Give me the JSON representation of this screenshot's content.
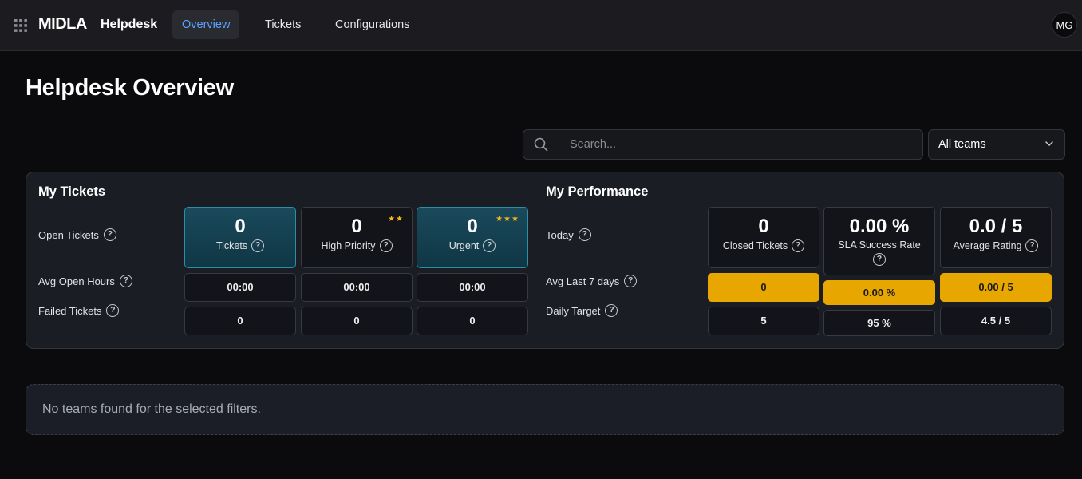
{
  "header": {
    "brand": "MIDLA",
    "module": "Helpdesk",
    "nav": [
      {
        "label": "Overview",
        "active": true
      },
      {
        "label": "Tickets",
        "active": false
      },
      {
        "label": "Configurations",
        "active": false
      }
    ],
    "user_initials": "MG"
  },
  "page": {
    "title": "Helpdesk Overview"
  },
  "filters": {
    "search_placeholder": "Search...",
    "team_selected": "All teams"
  },
  "my_tickets": {
    "title": "My Tickets",
    "row_labels": {
      "open": "Open Tickets",
      "avg_hours": "Avg Open Hours",
      "failed": "Failed Tickets"
    },
    "columns": [
      {
        "value": "0",
        "caption": "Tickets",
        "stars": "",
        "highlight": true,
        "avg_open_hours": "00:00",
        "failed": "0"
      },
      {
        "value": "0",
        "caption": "High Priority",
        "stars": "★★",
        "highlight": false,
        "avg_open_hours": "00:00",
        "failed": "0"
      },
      {
        "value": "0",
        "caption": "Urgent",
        "stars": "★★★",
        "highlight": true,
        "avg_open_hours": "00:00",
        "failed": "0"
      }
    ]
  },
  "my_performance": {
    "title": "My Performance",
    "row_labels": {
      "today": "Today",
      "avg_7_days": "Avg Last 7 days",
      "daily_target": "Daily Target"
    },
    "columns": [
      {
        "value": "0",
        "caption": "Closed Tickets",
        "avg_7_days": "0",
        "daily_target": "5"
      },
      {
        "value": "0.00 %",
        "caption": "SLA Success Rate",
        "avg_7_days": "0.00 %",
        "daily_target": "95 %"
      },
      {
        "value": "0.0 / 5",
        "caption": "Average Rating",
        "avg_7_days": "0.00 / 5",
        "daily_target": "4.5 / 5"
      }
    ]
  },
  "empty_state": {
    "message": "No teams found for the selected filters."
  },
  "colors": {
    "accent": "#5aa2ff",
    "highlight_teal": "#1a4a5c",
    "gold": "#e8a700",
    "star": "#f5b81a"
  }
}
